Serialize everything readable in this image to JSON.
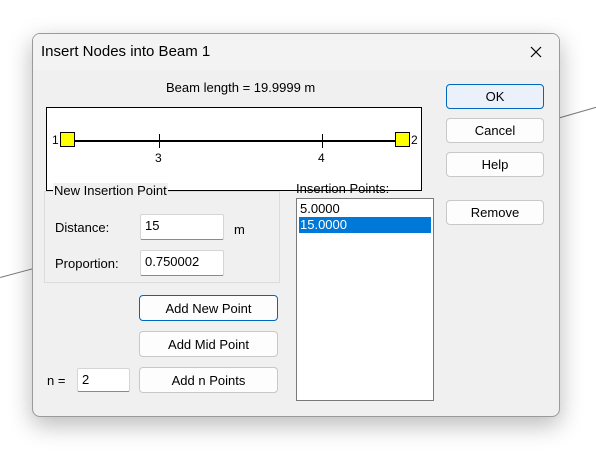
{
  "dialog": {
    "title": "Insert Nodes into Beam 1",
    "beam_length_label": "Beam length = 19.9999 m"
  },
  "beam": {
    "end_nodes": [
      "1",
      "2"
    ],
    "tick_labels": [
      "3",
      "4"
    ],
    "tick_positions": [
      0.25,
      0.75
    ],
    "node_color": "#ffff00"
  },
  "new_insertion_point": {
    "group_label": "New Insertion Point",
    "distance_label": "Distance:",
    "distance_value": "15",
    "distance_unit": "m",
    "proportion_label": "Proportion:",
    "proportion_value": "0.750002"
  },
  "buttons": {
    "ok": "OK",
    "cancel": "Cancel",
    "help": "Help",
    "remove": "Remove",
    "add_new_point": "Add New Point",
    "add_mid_point": "Add Mid Point",
    "add_n_points": "Add n Points"
  },
  "n_field": {
    "label": "n =",
    "value": "2"
  },
  "insertion_points": {
    "label": "Insertion Points:",
    "items": [
      "5.0000",
      "15.0000"
    ],
    "selected_index": 1
  },
  "colors": {
    "accent": "#0078d7",
    "selection": "#0078d7"
  }
}
